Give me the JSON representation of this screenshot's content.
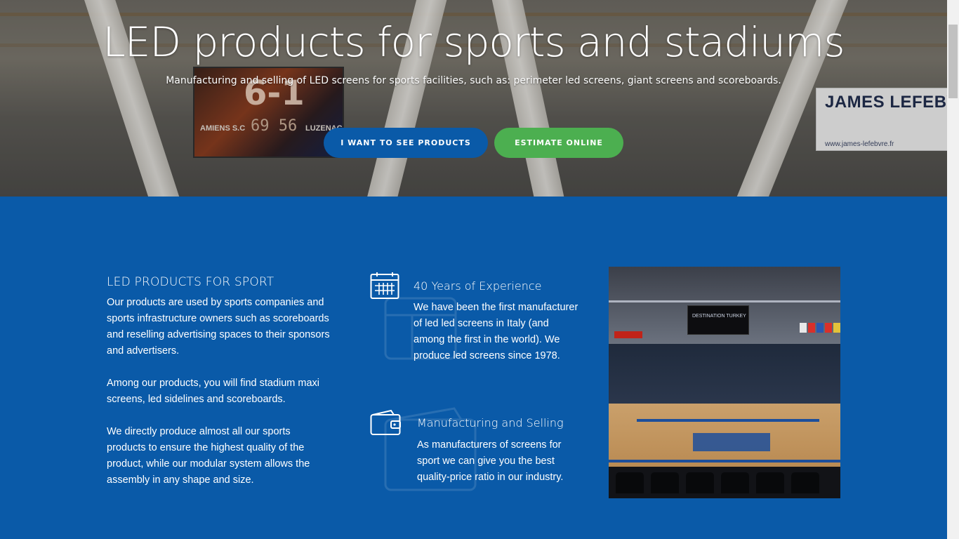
{
  "hero": {
    "title": "LED products for sports and stadiums",
    "subtitle": "Manufacturing and selling of LED screens for sports facilities, such as: perimeter led screens, giant screens and scoreboards.",
    "btn_products": "I want to see products",
    "btn_estimate": "Estimate online",
    "background": {
      "scoreboard_score": "6-1",
      "scoreboard_team_home": "AMIENS S.C",
      "scoreboard_team_away": "LUZENAC",
      "scoreboard_digits": "69 56",
      "banner_title": "JAMES LEFEBV",
      "banner_url": "www.james-lefebvre.fr"
    }
  },
  "main": {
    "left": {
      "title": "LED PRODUCTS FOR SPORT",
      "paragraphs": [
        "Our products are used by sports companies and sports infrastructure owners such as scoreboards and reselling advertising spaces to their sponsors and advertisers.",
        "Among our products, you will find stadium maxi screens, led sidelines and scoreboards.",
        "We directly produce almost all our sports products to ensure the highest quality of the product, while our modular system allows the assembly in any shape and size."
      ]
    },
    "features": [
      {
        "icon": "calendar-icon",
        "title": "40 Years of Experience",
        "text": "We have been the first manufacturer of led led screens in Italy (and among the first in the world). We produce led screens since 1978."
      },
      {
        "icon": "wallet-icon",
        "title": "Manufacturing and Selling",
        "text": "As manufacturers of screens for sport we can give you the best quality-price ratio in our industry."
      }
    ],
    "photo": {
      "cube_text": "DESTINATION TURKEY"
    }
  },
  "colors": {
    "section_blue": "#0a5aa8",
    "button_blue": "#0a5aa8",
    "button_green": "#4caf50",
    "text_white": "#ffffff"
  }
}
